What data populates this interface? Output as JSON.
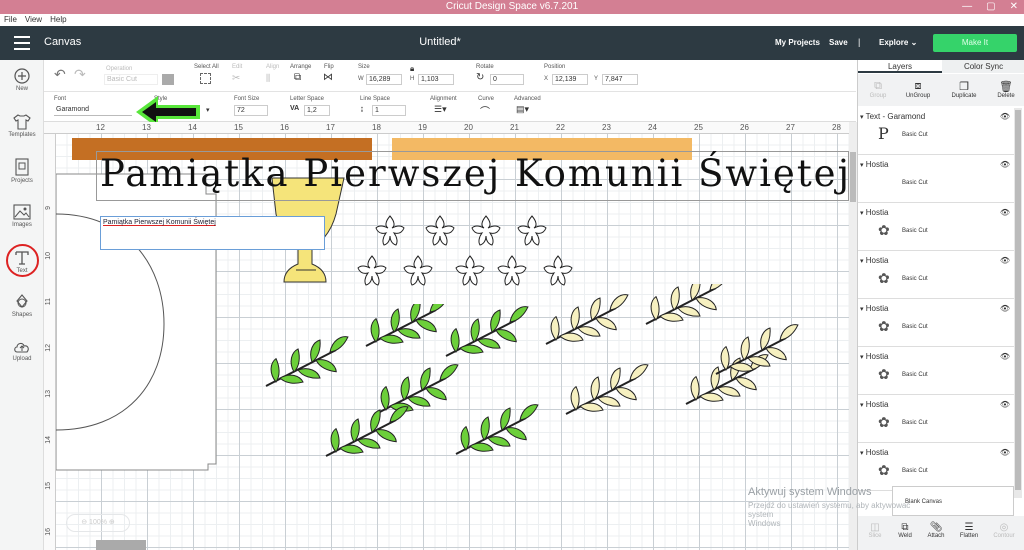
{
  "app": {
    "window_title": "Cricut Design Space  v6.7.201",
    "menu": [
      "File",
      "View",
      "Help"
    ]
  },
  "header": {
    "canvas_label": "Canvas",
    "doc_title": "Untitled*",
    "my_projects": "My Projects",
    "save": "Save",
    "separator": "|",
    "explore": "Explore",
    "make_it": "Make It"
  },
  "sidebar": {
    "items": [
      {
        "label": "New",
        "icon": "plus-circle-icon"
      },
      {
        "label": "Templates",
        "icon": "tshirt-icon"
      },
      {
        "label": "Projects",
        "icon": "projects-icon"
      },
      {
        "label": "Images",
        "icon": "image-icon"
      },
      {
        "label": "Text",
        "icon": "text-t-icon"
      },
      {
        "label": "Shapes",
        "icon": "shapes-icon"
      },
      {
        "label": "Upload",
        "icon": "upload-cloud-icon"
      }
    ]
  },
  "toolbar": {
    "operation_label": "Operation",
    "operation_value": "Basic Cut",
    "select_all": "Select All",
    "edit": "Edit",
    "align": "Align",
    "arrange": "Arrange",
    "flip": "Flip",
    "size": "Size",
    "size_w_label": "W",
    "size_w": "16,289",
    "size_h_label": "H",
    "size_h": "1,103",
    "rotate": "Rotate",
    "rotate_value": "0",
    "position": "Position",
    "pos_x_label": "X",
    "pos_x": "12,139",
    "pos_y_label": "Y",
    "pos_y": "7,847",
    "font_label": "Font",
    "font_value": "Garamond",
    "style_label": "Style",
    "font_size_label": "Font Size",
    "font_size": "72",
    "letter_space_label": "Letter Space",
    "letter_space": "1,2",
    "line_space_label": "Line Space",
    "line_space": "1",
    "alignment_label": "Alignment",
    "curve_label": "Curve",
    "advanced_label": "Advanced"
  },
  "ruler": {
    "top": [
      "12",
      "13",
      "14",
      "15",
      "16",
      "17",
      "18",
      "19",
      "20",
      "21",
      "22",
      "23",
      "24",
      "25",
      "26",
      "27",
      "28"
    ],
    "left": [
      "9",
      "10",
      "11",
      "12",
      "13",
      "14",
      "15",
      "16"
    ]
  },
  "canvas": {
    "big_text": "Pamiątka Pierwszej Komunii Świętej",
    "edit_box_text": "Pamiątka Pierwszej Komunii Świętej"
  },
  "layers_panel": {
    "tabs": [
      "Layers",
      "Color Sync"
    ],
    "actions": [
      "Group",
      "UnGroup",
      "Duplicate",
      "Delete"
    ],
    "layers": [
      {
        "title": "Text - Garamond",
        "sub": "Basic Cut",
        "thumb": "P"
      },
      {
        "title": "Hostia",
        "sub": "Basic Cut",
        "thumb": ""
      },
      {
        "title": "Hostia",
        "sub": "Basic Cut",
        "thumb": "flower"
      },
      {
        "title": "Hostia",
        "sub": "Basic Cut",
        "thumb": "flower"
      },
      {
        "title": "Hostia",
        "sub": "Basic Cut",
        "thumb": "flower"
      },
      {
        "title": "Hostia",
        "sub": "Basic Cut",
        "thumb": "flower"
      },
      {
        "title": "Hostia",
        "sub": "Basic Cut",
        "thumb": "flower"
      },
      {
        "title": "Hostia",
        "sub": "Basic Cut",
        "thumb": "flower"
      }
    ],
    "blank_canvas": "Blank Canvas",
    "bottom_actions": [
      "Slice",
      "Weld",
      "Attach",
      "Flatten",
      "Contour"
    ]
  },
  "watermark": {
    "line1": "Aktywuj system Windows",
    "line2": "Przejdź do ustawień systemu, aby aktywować system",
    "line3": "Windows"
  },
  "zoom": "100%",
  "colors": {
    "header_bg": "#2d3a42",
    "make_it": "#35d36a",
    "title_bar": "#d37f93",
    "leaf_green": "#6ccf3a",
    "leaf_cream": "#f6f0c0",
    "chalice_yellow": "#f5e47a",
    "bar_brown": "#c46f23",
    "bar_orange": "#f3b964",
    "arrow_green": "#58e63a"
  }
}
